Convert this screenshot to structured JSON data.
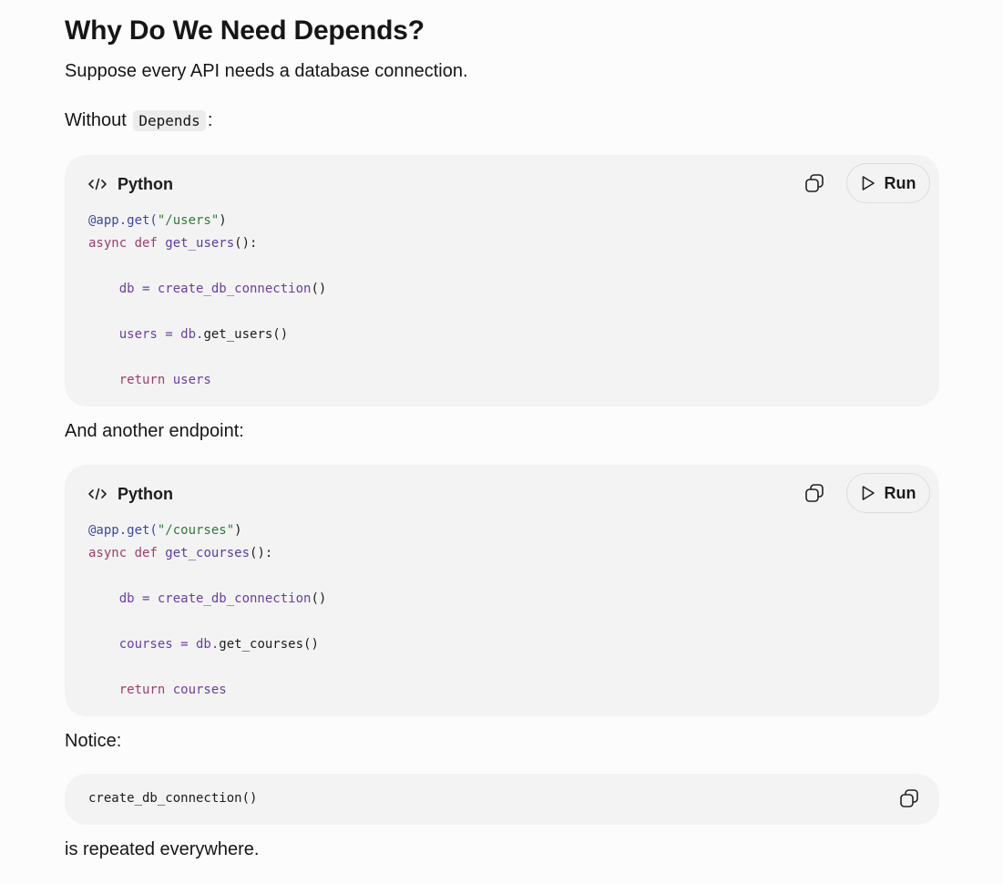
{
  "heading": "Why Do We Need Depends?",
  "intro": "Suppose every API needs a database connection.",
  "without_prefix": "Without",
  "without_code": "Depends",
  "without_suffix": ":",
  "another": "And another endpoint:",
  "notice": "Notice:",
  "repeated": "is repeated everywhere.",
  "block1": {
    "language": "Python",
    "run_label": "Run",
    "lines": [
      [
        {
          "t": "@app.get(",
          "c": "dec"
        },
        {
          "t": "\"/users\"",
          "c": "str"
        },
        {
          "t": ")",
          "c": "plain"
        }
      ],
      [
        {
          "t": "async def ",
          "c": "kw"
        },
        {
          "t": "get_users",
          "c": "fn"
        },
        {
          "t": "():",
          "c": "plain"
        }
      ],
      [],
      [
        {
          "t": "    db = create_db_connection",
          "c": "var"
        },
        {
          "t": "()",
          "c": "plain"
        }
      ],
      [],
      [
        {
          "t": "    users = db.",
          "c": "var"
        },
        {
          "t": "get_users()",
          "c": "plain"
        }
      ],
      [],
      [
        {
          "t": "    return ",
          "c": "kw"
        },
        {
          "t": "users",
          "c": "var"
        }
      ]
    ]
  },
  "block2": {
    "language": "Python",
    "run_label": "Run",
    "lines": [
      [
        {
          "t": "@app.get(",
          "c": "dec"
        },
        {
          "t": "\"/courses\"",
          "c": "str"
        },
        {
          "t": ")",
          "c": "plain"
        }
      ],
      [
        {
          "t": "async def ",
          "c": "kw"
        },
        {
          "t": "get_courses",
          "c": "fn"
        },
        {
          "t": "():",
          "c": "plain"
        }
      ],
      [],
      [
        {
          "t": "    db = create_db_connection",
          "c": "var"
        },
        {
          "t": "()",
          "c": "plain"
        }
      ],
      [],
      [
        {
          "t": "    courses = db.",
          "c": "var"
        },
        {
          "t": "get_courses()",
          "c": "plain"
        }
      ],
      [],
      [
        {
          "t": "    return ",
          "c": "kw"
        },
        {
          "t": "courses",
          "c": "var"
        }
      ]
    ]
  },
  "block3": {
    "code": "create_db_connection()"
  },
  "icons": {
    "lang": "code-icon",
    "copy": "copy-icon",
    "run": "play-icon"
  }
}
